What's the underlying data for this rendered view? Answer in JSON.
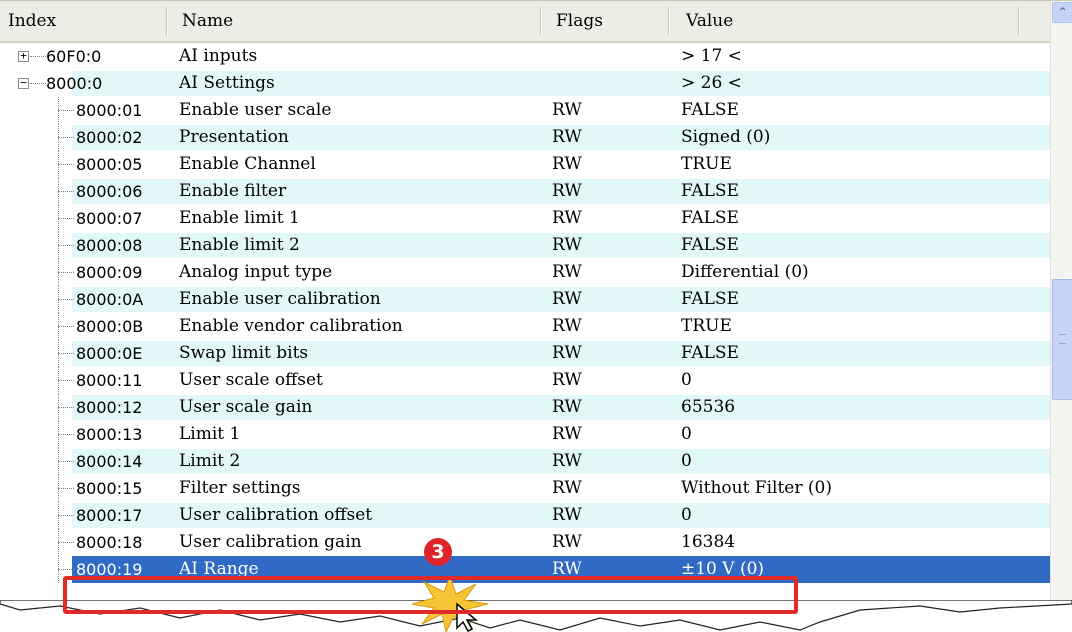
{
  "columns": {
    "index": "Index",
    "name": "Name",
    "flags": "Flags",
    "value": "Value"
  },
  "rows": [
    {
      "index": "60F0:0",
      "name": "AI inputs",
      "flags": "",
      "value": "> 17 <",
      "expander": "+"
    },
    {
      "index": "8000:0",
      "name": "AI Settings",
      "flags": "",
      "value": "> 26 <",
      "expander": "-"
    },
    {
      "index": "8000:01",
      "name": "Enable user scale",
      "flags": "RW",
      "value": "FALSE"
    },
    {
      "index": "8000:02",
      "name": "Presentation",
      "flags": "RW",
      "value": "Signed (0)"
    },
    {
      "index": "8000:05",
      "name": "Enable Channel",
      "flags": "RW",
      "value": "TRUE"
    },
    {
      "index": "8000:06",
      "name": "Enable filter",
      "flags": "RW",
      "value": "FALSE"
    },
    {
      "index": "8000:07",
      "name": "Enable limit 1",
      "flags": "RW",
      "value": "FALSE"
    },
    {
      "index": "8000:08",
      "name": "Enable limit 2",
      "flags": "RW",
      "value": "FALSE"
    },
    {
      "index": "8000:09",
      "name": "Analog input type",
      "flags": "RW",
      "value": "Differential (0)"
    },
    {
      "index": "8000:0A",
      "name": "Enable user calibration",
      "flags": "RW",
      "value": "FALSE"
    },
    {
      "index": "8000:0B",
      "name": "Enable vendor calibration",
      "flags": "RW",
      "value": "TRUE"
    },
    {
      "index": "8000:0E",
      "name": "Swap limit bits",
      "flags": "RW",
      "value": "FALSE"
    },
    {
      "index": "8000:11",
      "name": "User scale offset",
      "flags": "RW",
      "value": "0"
    },
    {
      "index": "8000:12",
      "name": "User scale gain",
      "flags": "RW",
      "value": "65536"
    },
    {
      "index": "8000:13",
      "name": "Limit 1",
      "flags": "RW",
      "value": "0"
    },
    {
      "index": "8000:14",
      "name": "Limit 2",
      "flags": "RW",
      "value": "0"
    },
    {
      "index": "8000:15",
      "name": "Filter settings",
      "flags": "RW",
      "value": "Without Filter (0)"
    },
    {
      "index": "8000:17",
      "name": "User calibration offset",
      "flags": "RW",
      "value": "0"
    },
    {
      "index": "8000:18",
      "name": "User calibration gain",
      "flags": "RW",
      "value": "16384"
    },
    {
      "index": "8000:19",
      "name": "AI Range",
      "flags": "RW",
      "value": "±10 V (0)",
      "selected": true
    }
  ],
  "annotation": {
    "badge": "3"
  },
  "colors": {
    "selection": "#316ac5",
    "alt_row": "#e2f8f8",
    "highlight_box": "#e02a2a",
    "badge": "#e0232a"
  },
  "icons": {
    "scroll_up": "chevron-up-icon",
    "expand": "plus-box-icon",
    "collapse": "minus-box-icon",
    "pointer": "mouse-cursor-icon",
    "burst": "star-burst-icon"
  }
}
